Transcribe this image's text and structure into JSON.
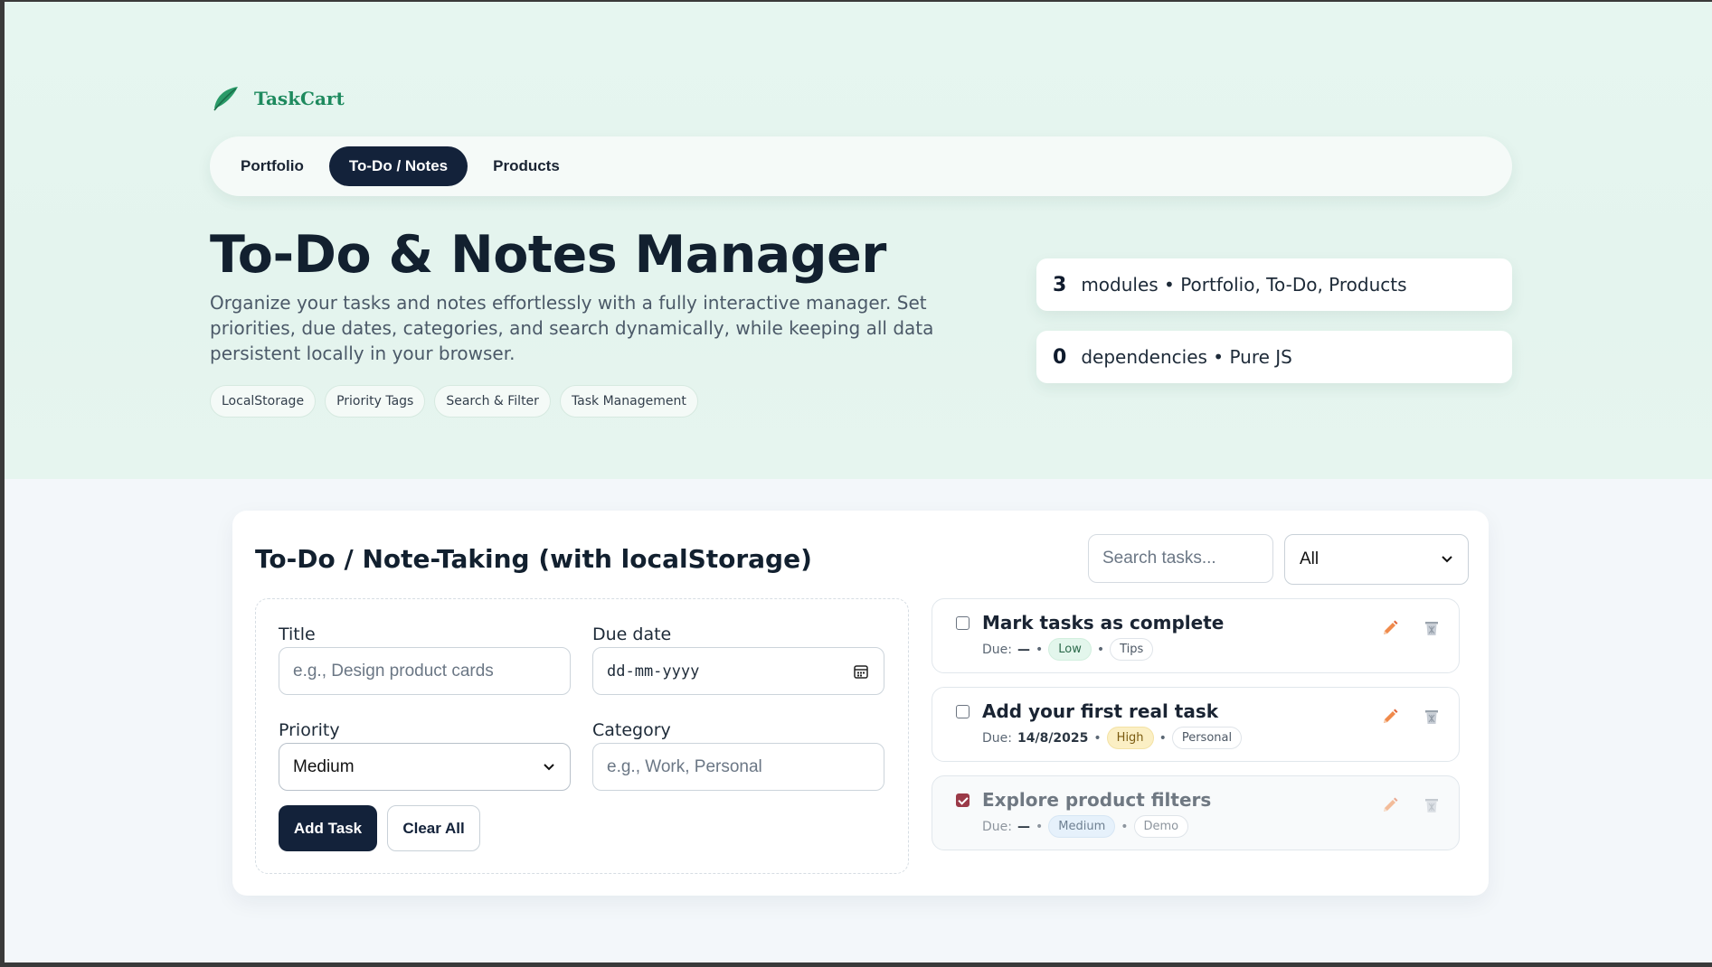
{
  "brand": {
    "name": "TaskCart"
  },
  "nav": [
    {
      "label": "Portfolio"
    },
    {
      "label": "To-Do / Notes",
      "active": true
    },
    {
      "label": "Products"
    }
  ],
  "hero": {
    "title": "To-Do & Notes Manager",
    "description": "Organize your tasks and notes effortlessly with a fully interactive manager. Set priorities, due dates, categories, and search dynamically, while keeping all data persistent locally in your browser.",
    "tags": [
      "LocalStorage",
      "Priority Tags",
      "Search & Filter",
      "Task Management"
    ]
  },
  "stats": [
    {
      "number": "3",
      "text": "modules • Portfolio, To-Do, Products"
    },
    {
      "number": "0",
      "text": "dependencies • Pure JS"
    }
  ],
  "panel": {
    "title": "To-Do / Note-Taking (with localStorage)",
    "search_placeholder": "Search tasks...",
    "filter_value": "All"
  },
  "form": {
    "title_label": "Title",
    "title_placeholder": "e.g., Design product cards",
    "due_label": "Due date",
    "due_placeholder": "dd-mm-yyyy",
    "priority_label": "Priority",
    "priority_value": "Medium",
    "category_label": "Category",
    "category_placeholder": "e.g., Work, Personal",
    "add_label": "Add Task",
    "clear_label": "Clear All"
  },
  "tasks": [
    {
      "title": "Mark tasks as complete",
      "due_label": "Due:",
      "due": "—",
      "priority": "Low",
      "category": "Tips",
      "done": false
    },
    {
      "title": "Add your first real task",
      "due_label": "Due:",
      "due": "14/8/2025",
      "priority": "High",
      "category": "Personal",
      "done": false
    },
    {
      "title": "Explore product filters",
      "due_label": "Due:",
      "due": "—",
      "priority": "Medium",
      "category": "Demo",
      "done": true
    }
  ],
  "colors": {
    "brand_green": "#1e8a5e",
    "navy": "#13223a",
    "checked": "#9b3a48",
    "edit_orange": "#f08a4b"
  },
  "icons": {
    "brand": "leaf-icon",
    "edit": "pencil-icon",
    "delete": "trash-icon",
    "date": "calendar-icon",
    "select": "chevron-down-icon"
  }
}
